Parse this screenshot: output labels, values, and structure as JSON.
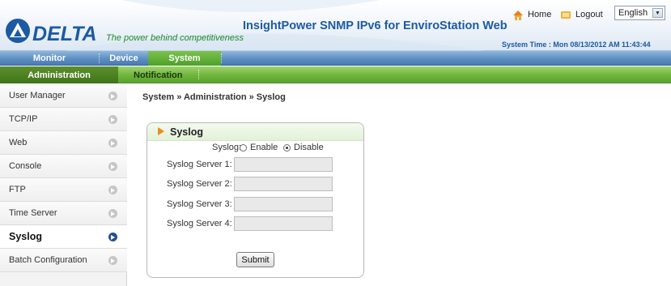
{
  "header": {
    "brand": "DELTA",
    "tagline": "The power behind competitiveness",
    "app_title": "InsightPower SNMP IPv6 for EnviroStation Web",
    "home_label": "Home",
    "logout_label": "Logout",
    "language": "English",
    "system_time": "System Time : Mon 08/13/2012 AM 11:43:44",
    "brand_color": "#1c5aa3",
    "tagline_color": "#1f8a2a"
  },
  "main_nav": {
    "tabs": [
      {
        "label": "Monitor",
        "active": false
      },
      {
        "label": "Device",
        "active": false
      },
      {
        "label": "System",
        "active": true
      }
    ]
  },
  "sub_nav": {
    "tabs": [
      {
        "label": "Administration",
        "active": true
      },
      {
        "label": "Notification",
        "active": false
      }
    ]
  },
  "sidebar": {
    "items": [
      {
        "label": "User Manager",
        "active": false
      },
      {
        "label": "TCP/IP",
        "active": false
      },
      {
        "label": "Web",
        "active": false
      },
      {
        "label": "Console",
        "active": false
      },
      {
        "label": "FTP",
        "active": false
      },
      {
        "label": "Time Server",
        "active": false
      },
      {
        "label": "Syslog",
        "active": true
      },
      {
        "label": "Batch Configuration",
        "active": false
      }
    ]
  },
  "content": {
    "breadcrumb": "System » Administration » Syslog",
    "panel": {
      "title": "Syslog",
      "syslog_label": "Syslog:",
      "enable_label": "Enable",
      "disable_label": "Disable",
      "selected": "Disable",
      "servers": [
        {
          "label": "Syslog Server 1:",
          "value": ""
        },
        {
          "label": "Syslog Server 2:",
          "value": ""
        },
        {
          "label": "Syslog Server 3:",
          "value": ""
        },
        {
          "label": "Syslog Server 4:",
          "value": ""
        }
      ],
      "submit_label": "Submit"
    }
  }
}
